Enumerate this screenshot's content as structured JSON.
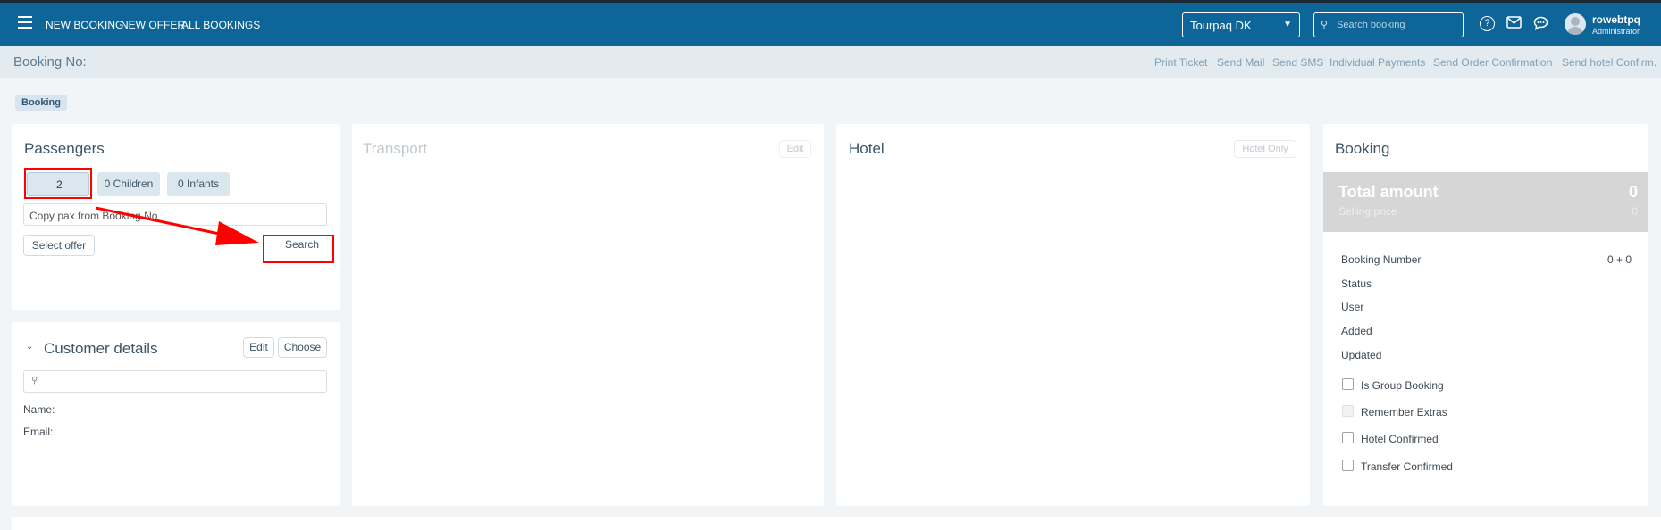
{
  "navbar": {
    "links": [
      "NEW BOOKING",
      "NEW OFFER",
      "ALL BOOKINGS"
    ],
    "company_select": "Tourpaq DK",
    "search_placeholder": "Search booking",
    "user": {
      "name": "rowebtpq",
      "role": "Administrator"
    },
    "colors": {
      "bar": "#0e6597"
    }
  },
  "subheader": {
    "title": "Booking No:",
    "actions": [
      "Print Ticket",
      "Send Mail",
      "Send SMS",
      "Individual Payments",
      "Send Order Confirmation",
      "Send hotel Confirm."
    ]
  },
  "tab": "Booking",
  "passengers": {
    "title": "Passengers",
    "adults_value": "2",
    "children_label": "0 Children",
    "infants_label": "0 Infants",
    "copy_placeholder": "Copy pax from Booking No",
    "select_offer": "Select offer",
    "search": "Search"
  },
  "customer": {
    "title": "Customer details",
    "edit": "Edit",
    "choose": "Choose",
    "name_label": "Name:",
    "email_label": "Email:"
  },
  "transport": {
    "title": "Transport",
    "edit": "Edit"
  },
  "hotel": {
    "title": "Hotel",
    "hotel_only": "Hotel Only"
  },
  "booking": {
    "title": "Booking",
    "total_label": "Total amount",
    "total_value": "0",
    "selling_label": "Selling price",
    "selling_value": "0",
    "booking_number_label": "Booking Number",
    "booking_number_value": "0 + 0",
    "status_label": "Status",
    "user_label": "User",
    "added_label": "Added",
    "updated_label": "Updated",
    "checkboxes": [
      "Is Group Booking",
      "Remember Extras",
      "Hotel Confirmed",
      "Transfer Confirmed"
    ]
  }
}
